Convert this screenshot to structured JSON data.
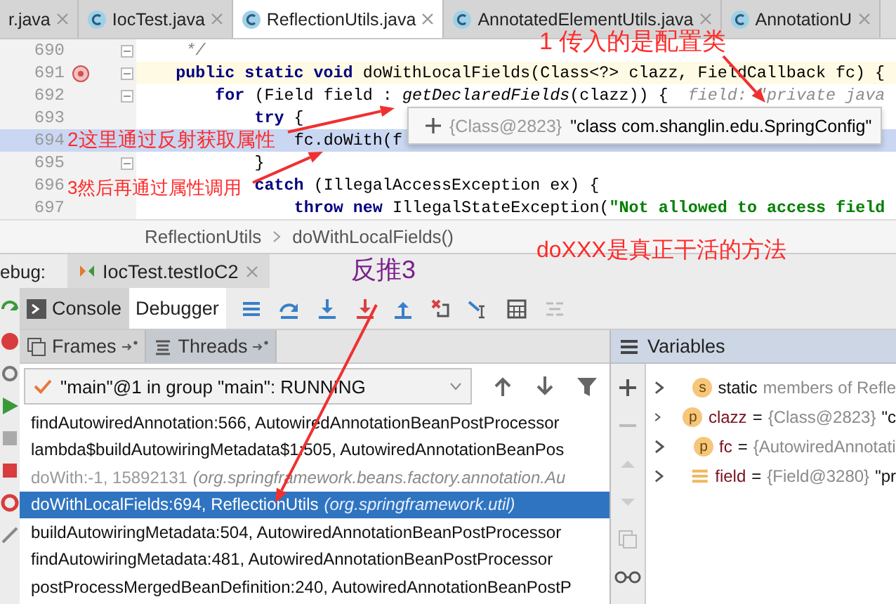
{
  "editor_tabs": [
    {
      "label": "r.java",
      "selected": false,
      "icon": false
    },
    {
      "label": "IocTest.java",
      "selected": false,
      "icon": true
    },
    {
      "label": "ReflectionUtils.java",
      "selected": true,
      "icon": true
    },
    {
      "label": "AnnotatedElementUtils.java",
      "selected": false,
      "icon": true
    },
    {
      "label": "AnnotationU",
      "selected": false,
      "icon": true
    }
  ],
  "code_lines": [
    {
      "number": "690",
      "kind": "plain",
      "breakpoint": false,
      "fold": true,
      "segments": [
        {
          "text": "*/",
          "kind": "comment"
        }
      ]
    },
    {
      "number": "691",
      "kind": "caret",
      "breakpoint": true,
      "fold": true,
      "segments": [
        {
          "text": "public static void ",
          "kind": "keyword"
        },
        {
          "text": "doWithLocalFields(Class<?> clazz, FieldCallback fc) {",
          "kind": "plain"
        }
      ]
    },
    {
      "number": "692",
      "kind": "plain",
      "breakpoint": false,
      "fold": true,
      "segments": [
        {
          "text": "for ",
          "kind": "keyword"
        },
        {
          "text": "(Field field : ",
          "kind": "plain"
        },
        {
          "text": "getDeclaredFields",
          "kind": "call"
        },
        {
          "text": "(clazz)) {",
          "kind": "plain"
        },
        {
          "text": "  field: \"private java",
          "kind": "hint"
        }
      ]
    },
    {
      "number": "693",
      "kind": "plain",
      "breakpoint": false,
      "fold": false,
      "segments": [
        {
          "text": "try ",
          "kind": "keyword"
        },
        {
          "text": "{",
          "kind": "plain"
        }
      ]
    },
    {
      "number": "694",
      "kind": "execution",
      "breakpoint": false,
      "fold": false,
      "segments": [
        {
          "text": "fc.doWith(f",
          "kind": "plain"
        }
      ]
    },
    {
      "number": "695",
      "kind": "plain",
      "breakpoint": false,
      "fold": true,
      "segments": [
        {
          "text": "}",
          "kind": "plain"
        }
      ]
    },
    {
      "number": "696",
      "kind": "plain",
      "breakpoint": false,
      "fold": false,
      "segments": [
        {
          "text": "catch ",
          "kind": "keyword"
        },
        {
          "text": "(IllegalAccessException ex) {",
          "kind": "plain"
        }
      ]
    },
    {
      "number": "697",
      "kind": "plain",
      "breakpoint": false,
      "fold": false,
      "segments": [
        {
          "text": "throw new ",
          "kind": "keyword"
        },
        {
          "text": "IllegalStateException(",
          "kind": "plain"
        },
        {
          "text": "\"Not allowed to access field",
          "kind": "string"
        }
      ]
    }
  ],
  "tooltip": {
    "ref": "{Class@2823}",
    "value": "\"class com.shanglin.edu.SpringConfig\""
  },
  "breadcrumb": [
    "ReflectionUtils",
    "doWithLocalFields()"
  ],
  "debug": {
    "label": "ebug:",
    "session": "IocTest.testIoC2"
  },
  "debug_tabs": [
    {
      "label": "Console",
      "selected": false
    },
    {
      "label": "Debugger",
      "selected": true
    }
  ],
  "frame_tabs": [
    {
      "label": "Frames",
      "selected": true
    },
    {
      "label": "Threads",
      "selected": false
    }
  ],
  "thread": "\"main\"@1 in group \"main\": RUNNING",
  "frames": [
    {
      "text": "findAutowiredAnnotation:566, AutowiredAnnotationBeanPostProcessor",
      "kind": "normal",
      "selected": false
    },
    {
      "text": "lambda$buildAutowiringMetadata$1:505, AutowiredAnnotationBeanPos",
      "kind": "normal",
      "selected": false
    },
    {
      "text": "doWith:-1, 15892131",
      "package": "(org.springframework.beans.factory.annotation.Au",
      "kind": "synthetic",
      "selected": false
    },
    {
      "text": "doWithLocalFields:694, ReflectionUtils",
      "package": "(org.springframework.util)",
      "kind": "normal",
      "selected": true
    },
    {
      "text": "buildAutowiringMetadata:504, AutowiredAnnotationBeanPostProcessor",
      "kind": "normal",
      "selected": false
    },
    {
      "text": "findAutowiringMetadata:481, AutowiredAnnotationBeanPostProcessor",
      "kind": "normal",
      "selected": false
    },
    {
      "text": "postProcessMergedBeanDefinition:240, AutowiredAnnotationBeanPostP",
      "kind": "normal",
      "selected": false
    }
  ],
  "variables_title": "Variables",
  "variables": [
    {
      "kind": "static",
      "badge": "s",
      "name": "static",
      "ref": "members of Refle"
    },
    {
      "kind": "param",
      "badge": "p",
      "name": "clazz",
      "operator": "=",
      "ref": "{Class@2823}",
      "value": "\"c"
    },
    {
      "kind": "param",
      "badge": "p",
      "name": "fc",
      "operator": "=",
      "ref": "{AutowiredAnnotati"
    },
    {
      "kind": "field",
      "name": "field",
      "operator": "=",
      "ref": "{Field@3280}",
      "value": "\"pr"
    }
  ],
  "annotations": [
    {
      "text": "1 传入的是配置类",
      "color": "#ff2a2a"
    },
    {
      "text": "2这里通过反射获取属性",
      "color": "#ff2a2a"
    },
    {
      "text": "3然后再通过属性调用",
      "color": "#ff2a2a"
    },
    {
      "text": "反推3",
      "color": "#7b1f8c"
    },
    {
      "text": "doXXX是真正干活的方法",
      "color": "#ff2a2a"
    }
  ]
}
